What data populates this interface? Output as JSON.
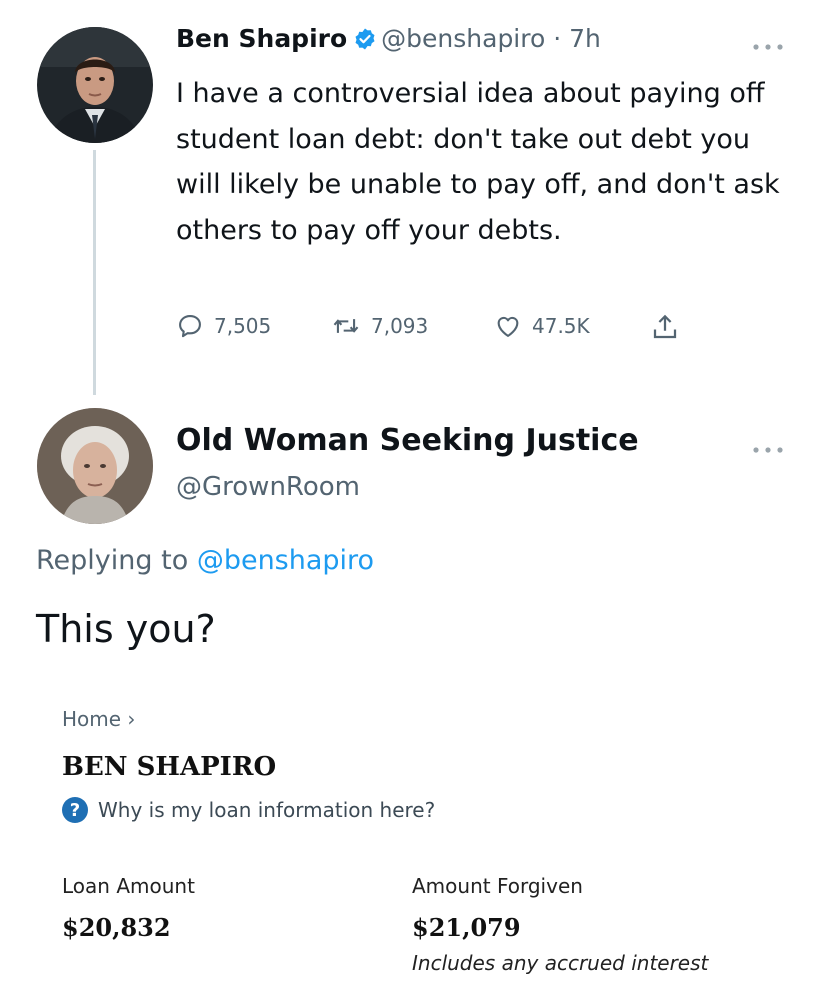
{
  "original_tweet": {
    "author_name": "Ben Shapiro",
    "handle_time": "@benshapiro · 7h",
    "text": "I have a controversial idea about paying off student loan debt: don't take out debt you will likely be unable to pay off, and don't ask others to pay off your debts.",
    "more_icon": "more-icon",
    "actions": {
      "replies": "7,505",
      "retweets": "7,093",
      "likes": "47.5K"
    }
  },
  "reply_tweet": {
    "author_name": "Old Woman Seeking Justice",
    "handle": "@GrownRoom",
    "replying_prefix": "Replying to",
    "replying_mention": "@benshapiro",
    "text": "This you?"
  },
  "screenshot": {
    "breadcrumb": "Home ›",
    "borrower_name": "BEN SHAPIRO",
    "help_link": "Why is my loan information here?",
    "loan_amount_label": "Loan Amount",
    "loan_amount_value": "$20,832",
    "forgiven_label": "Amount Forgiven",
    "forgiven_value": "$21,079",
    "forgiven_note": "Includes any accrued interest"
  },
  "colors": {
    "verified": "#1d9bf0",
    "mention": "#1d9bf0",
    "muted": "#536471",
    "help_badge": "#1f6fb4"
  }
}
